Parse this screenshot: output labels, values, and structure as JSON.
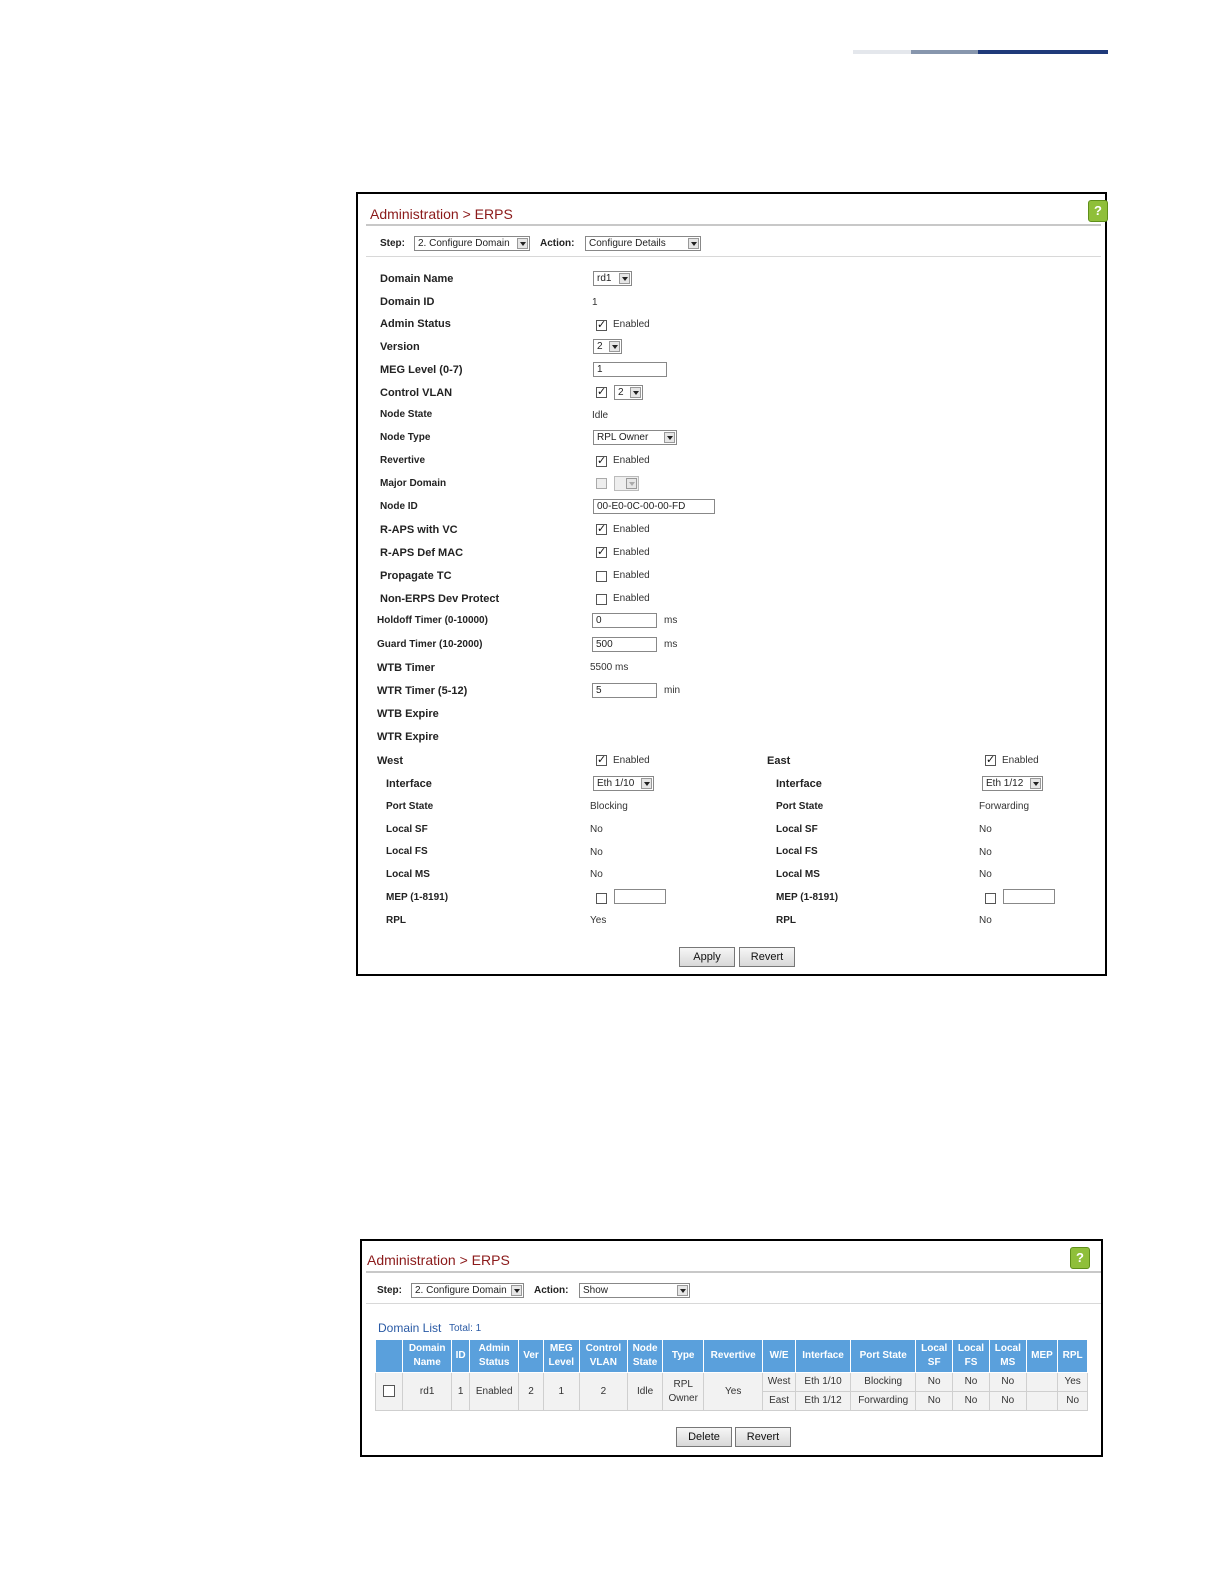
{
  "panel1": {
    "breadcrumb": "Administration > ERPS",
    "step_label": "Step:",
    "step_value": "2. Configure Domain",
    "action_label": "Action:",
    "action_value": "Configure Details",
    "fields": {
      "domain_name": {
        "label": "Domain Name",
        "value": "rd1"
      },
      "domain_id": {
        "label": "Domain ID",
        "value": "1"
      },
      "admin_status": {
        "label": "Admin Status",
        "value": "Enabled"
      },
      "version": {
        "label": "Version",
        "value": "2"
      },
      "meg_level": {
        "label": "MEG Level (0-7)",
        "value": "1"
      },
      "control_vlan": {
        "label": "Control VLAN",
        "value": "2"
      },
      "node_state": {
        "label": "Node State",
        "value": "Idle"
      },
      "node_type": {
        "label": "Node Type",
        "value": "RPL Owner"
      },
      "revertive": {
        "label": "Revertive",
        "value": "Enabled"
      },
      "major_domain": {
        "label": "Major Domain"
      },
      "node_id": {
        "label": "Node ID",
        "value": "00-E0-0C-00-00-FD"
      },
      "raps_vc": {
        "label": "R-APS with VC",
        "value": "Enabled"
      },
      "raps_def_mac": {
        "label": "R-APS Def MAC",
        "value": "Enabled"
      },
      "propagate_tc": {
        "label": "Propagate TC",
        "value": "Enabled"
      },
      "non_erps": {
        "label": "Non-ERPS Dev Protect",
        "value": "Enabled"
      },
      "holdoff": {
        "label": "Holdoff Timer (0-10000)",
        "value": "0",
        "unit": "ms"
      },
      "guard": {
        "label": "Guard Timer (10-2000)",
        "value": "500",
        "unit": "ms"
      },
      "wtb_timer": {
        "label": "WTB Timer",
        "value": "5500 ms"
      },
      "wtr_timer": {
        "label": "WTR Timer (5-12)",
        "value": "5",
        "unit": "min"
      },
      "wtb_expire": {
        "label": "WTB Expire"
      },
      "wtr_expire": {
        "label": "WTR Expire"
      }
    },
    "west": {
      "label": "West",
      "enabled": "Enabled",
      "interface_label": "Interface",
      "interface": "Eth 1/10",
      "port_state_label": "Port State",
      "port_state": "Blocking",
      "local_sf_label": "Local SF",
      "local_sf": "No",
      "local_fs_label": "Local FS",
      "local_fs": "No",
      "local_ms_label": "Local MS",
      "local_ms": "No",
      "mep_label": "MEP (1-8191)",
      "rpl_label": "RPL",
      "rpl": "Yes"
    },
    "east": {
      "label": "East",
      "enabled": "Enabled",
      "interface_label": "Interface",
      "interface": "Eth 1/12",
      "port_state_label": "Port State",
      "port_state": "Forwarding",
      "local_sf_label": "Local SF",
      "local_sf": "No",
      "local_fs_label": "Local FS",
      "local_fs": "No",
      "local_ms_label": "Local MS",
      "local_ms": "No",
      "mep_label": "MEP (1-8191)",
      "rpl_label": "RPL",
      "rpl": "No"
    },
    "apply": "Apply",
    "revert": "Revert"
  },
  "panel2": {
    "breadcrumb": "Administration > ERPS",
    "step_label": "Step:",
    "step_value": "2. Configure Domain",
    "action_label": "Action:",
    "action_value": "Show",
    "list_title": "Domain List",
    "total": "Total: 1",
    "headers": {
      "domain_name": [
        "Domain",
        "Name"
      ],
      "id": "ID",
      "admin_status": [
        "Admin",
        "Status"
      ],
      "ver": "Ver",
      "meg_level": [
        "MEG",
        "Level"
      ],
      "control_vlan": [
        "Control",
        "VLAN"
      ],
      "node_state": [
        "Node",
        "State"
      ],
      "type": "Type",
      "revertive": "Revertive",
      "we": "W/E",
      "interface": "Interface",
      "port_state": "Port State",
      "local_sf": [
        "Local",
        "SF"
      ],
      "local_fs": [
        "Local",
        "FS"
      ],
      "local_ms": [
        "Local",
        "MS"
      ],
      "mep": "MEP",
      "rpl": "RPL"
    },
    "row": {
      "domain_name": "rd1",
      "id": "1",
      "admin_status": "Enabled",
      "ver": "2",
      "meg_level": "1",
      "control_vlan": "2",
      "node_state": "Idle",
      "type": [
        "RPL",
        "Owner"
      ],
      "revertive": "Yes",
      "ports": [
        {
          "we": "West",
          "interface": "Eth 1/10",
          "port_state": "Blocking",
          "local_sf": "No",
          "local_fs": "No",
          "local_ms": "No",
          "mep": "",
          "rpl": "Yes"
        },
        {
          "we": "East",
          "interface": "Eth 1/12",
          "port_state": "Forwarding",
          "local_sf": "No",
          "local_fs": "No",
          "local_ms": "No",
          "mep": "",
          "rpl": "No"
        }
      ]
    },
    "delete": "Delete",
    "revert": "Revert"
  },
  "colors": {
    "accent": "#8b1a1a",
    "table_header": "#5aa0dc",
    "link": "#2a5aa5"
  }
}
